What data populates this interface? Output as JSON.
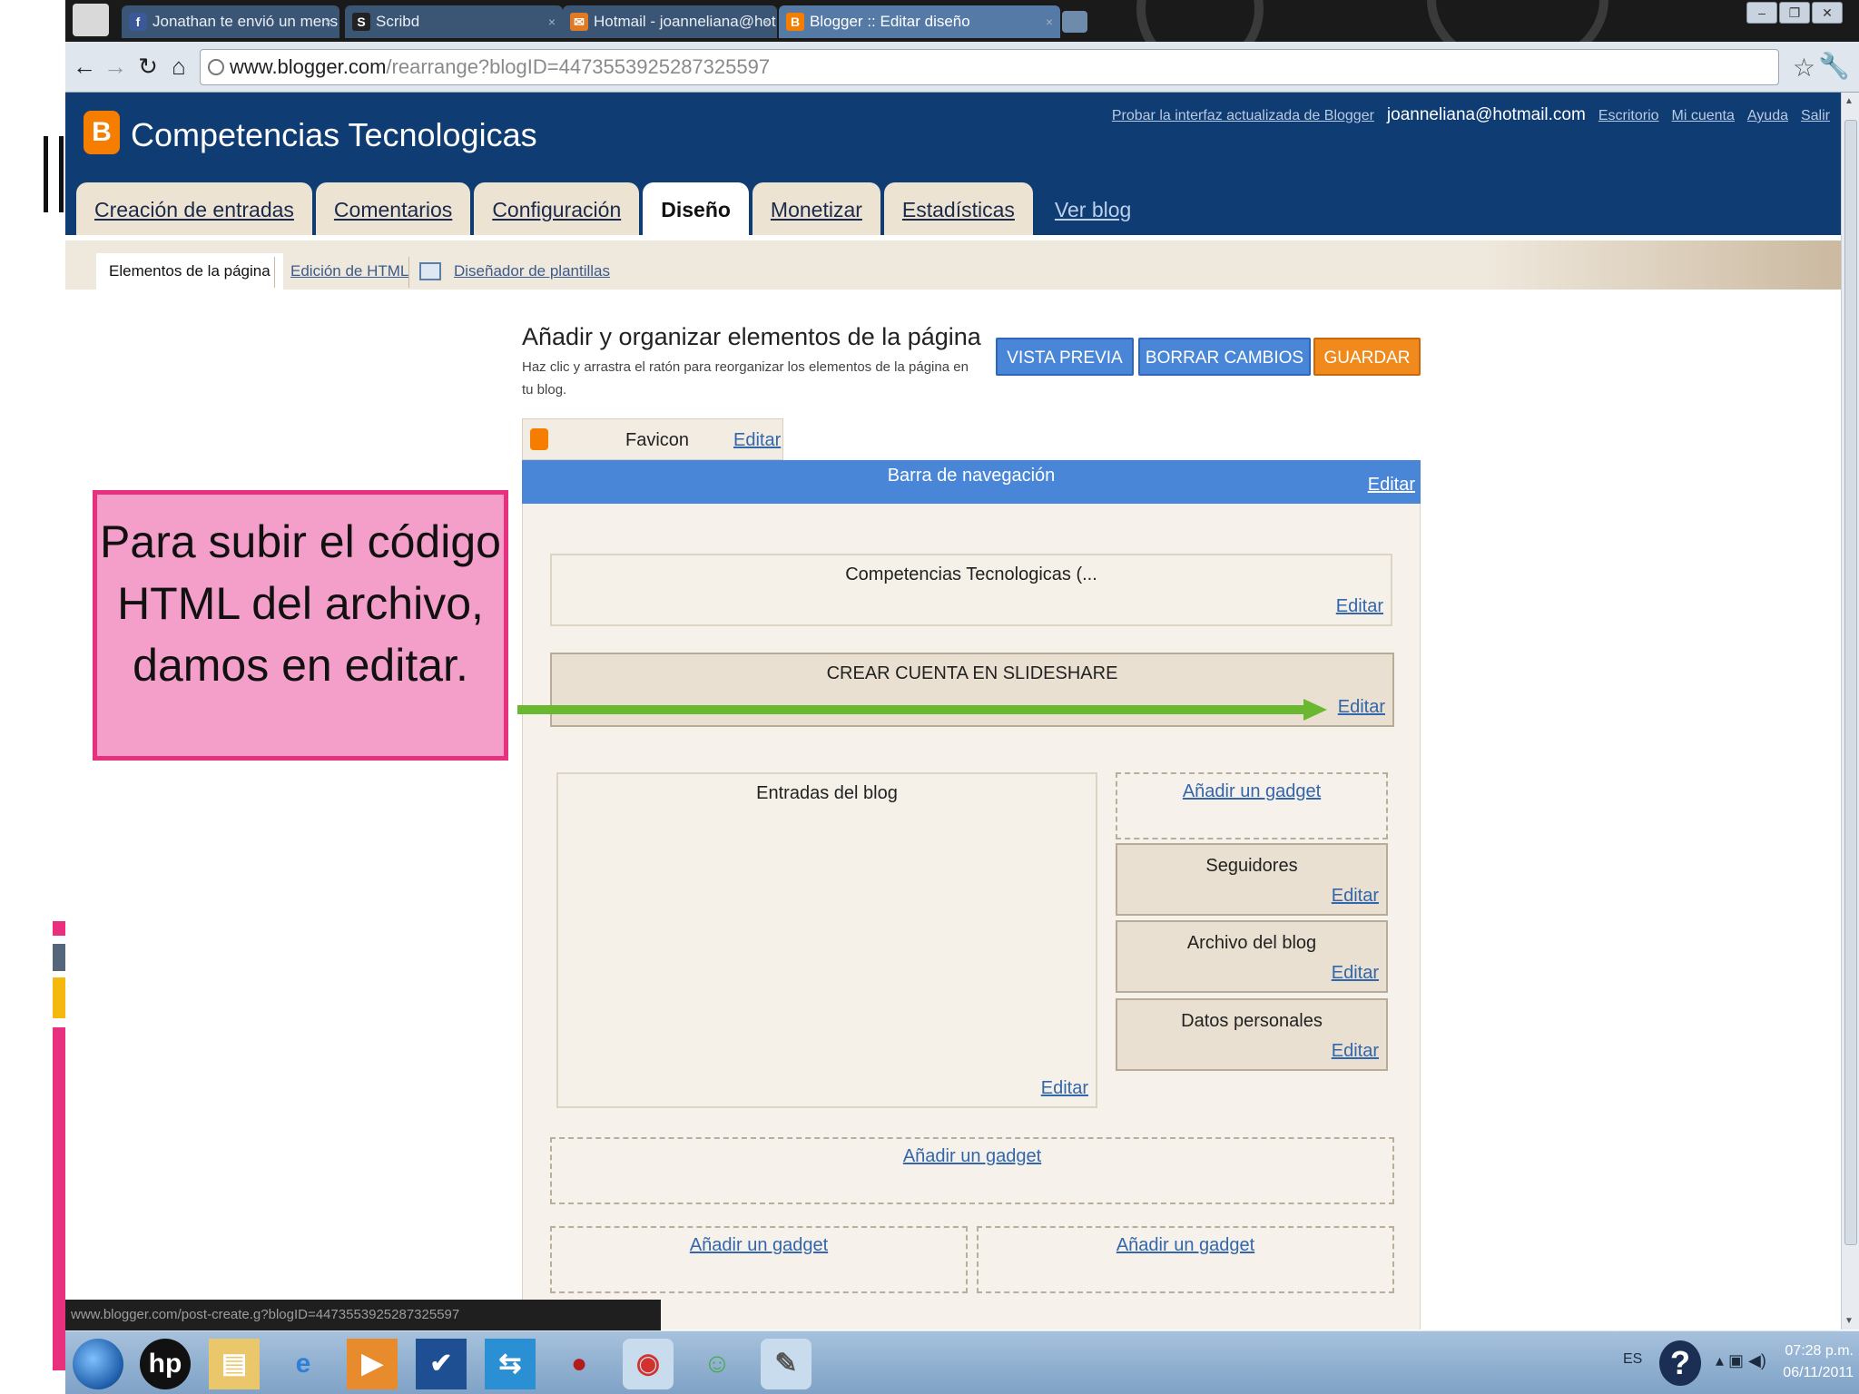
{
  "browser": {
    "tabs": [
      {
        "icon": "f",
        "label": "Jonathan te envió un mens",
        "color": "#3b5998"
      },
      {
        "icon": "S",
        "label": "Scribd",
        "color": "#222222"
      },
      {
        "icon": "✉",
        "label": "Hotmail - joanneliana@hot",
        "color": "#e07b24"
      },
      {
        "icon": "B",
        "label": "Blogger :: Editar diseño",
        "color": "#f57d00"
      }
    ],
    "url_host": "www.blogger.com",
    "url_path": "/rearrange?blogID=4473553925287325597",
    "status_url": "www.blogger.com/post-create.g?blogID=4473553925287325597"
  },
  "blogger": {
    "blog_title": "Competencias Tecnologicas",
    "user_links": {
      "try_new": "Probar la interfaz actualizada de Blogger",
      "email": "joanneliana@hotmail.com",
      "desk": "Escritorio",
      "account": "Mi cuenta",
      "help": "Ayuda",
      "logout": "Salir"
    },
    "tabs": [
      "Creación de entradas",
      "Comentarios",
      "Configuración",
      "Diseño",
      "Monetizar",
      "Estadísticas"
    ],
    "view_blog": "Ver blog",
    "sub_tabs": [
      "Elementos de la página",
      "Edición de HTML",
      "Diseñador de plantillas"
    ]
  },
  "editor": {
    "heading": "Añadir y organizar elementos de la página",
    "subheading": "Haz clic y arrastra el ratón para reorganizar los elementos de la página en tu blog.",
    "btn_preview": "VISTA PREVIA",
    "btn_clear": "BORRAR CAMBIOS",
    "btn_save": "GUARDAR",
    "favicon_label": "Favicon",
    "edit": "Editar",
    "navbar_label": "Barra de navegación",
    "header_widget": "Competencias Tecnologicas (...",
    "slideshare_widget": "CREAR CUENTA EN SLIDESHARE",
    "posts_widget": "Entradas del blog",
    "add_gadget": "Añadir un gadget",
    "sidebar_widgets": [
      "Seguidores",
      "Archivo del blog",
      "Datos personales"
    ]
  },
  "annotation": {
    "text": "Para subir el código HTML del archivo, damos en editar.",
    "arrow_color": "#6ab82f"
  },
  "taskbar": {
    "lang": "ES",
    "time": "07:28 p.m.",
    "date": "06/11/2011"
  },
  "colors": {
    "blogger_blue": "#0e3c73",
    "blogger_orange": "#f57d00",
    "button_blue": "#4a86d8",
    "save_orange": "#f08a1c",
    "callout_pink": "#f49fc9",
    "callout_border": "#e8307e"
  }
}
